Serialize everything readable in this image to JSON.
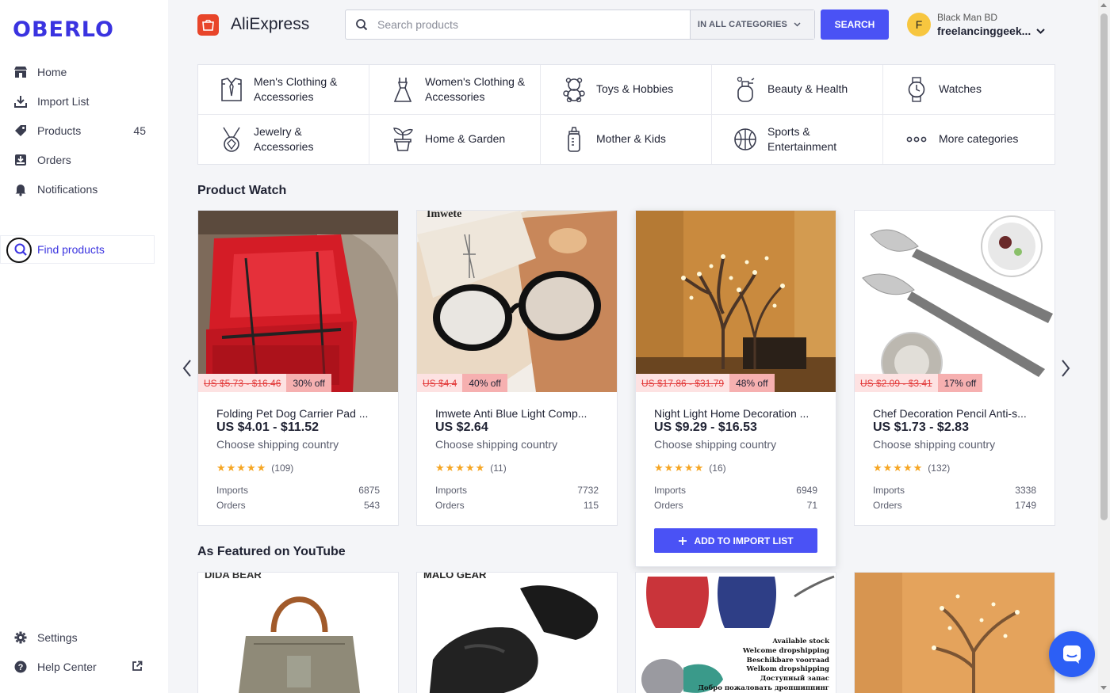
{
  "app": {
    "logo": "OBERLO"
  },
  "sidebar": {
    "items": [
      {
        "label": "Home",
        "icon": "store-icon"
      },
      {
        "label": "Import List",
        "icon": "download-icon"
      },
      {
        "label": "Products",
        "icon": "tag-icon",
        "count": "45"
      },
      {
        "label": "Orders",
        "icon": "inbox-icon"
      },
      {
        "label": "Notifications",
        "icon": "bell-icon"
      },
      {
        "label": "Find products",
        "icon": "search-icon",
        "active": true
      }
    ],
    "bottom": [
      {
        "label": "Settings",
        "icon": "gear-icon"
      },
      {
        "label": "Help Center",
        "icon": "help-icon"
      }
    ]
  },
  "header": {
    "store_name": "AliExpress",
    "search_placeholder": "Search products",
    "category_select": "IN ALL CATEGORIES",
    "search_button": "SEARCH",
    "user": {
      "initial": "F",
      "name": "Black Man BD",
      "email": "freelancinggeek..."
    }
  },
  "categories": [
    {
      "label": "Men's Clothing & Accessories",
      "icon": "shirt-tie-icon"
    },
    {
      "label": "Women's Clothing & Accessories",
      "icon": "dress-icon"
    },
    {
      "label": "Toys & Hobbies",
      "icon": "teddy-bear-icon"
    },
    {
      "label": "Beauty & Health",
      "icon": "perfume-icon"
    },
    {
      "label": "Watches",
      "icon": "watch-icon"
    },
    {
      "label": "Jewelry & Accessories",
      "icon": "necklace-icon"
    },
    {
      "label": "Home & Garden",
      "icon": "plant-pot-icon"
    },
    {
      "label": "Mother & Kids",
      "icon": "baby-bottle-icon"
    },
    {
      "label": "Sports & Entertainment",
      "icon": "basketball-icon"
    },
    {
      "label": "More categories",
      "icon": "more-dots-icon"
    }
  ],
  "product_watch": {
    "title": "Product Watch",
    "imports_label": "Imports",
    "orders_label": "Orders",
    "add_button": "ADD TO IMPORT LIST",
    "products": [
      {
        "title": "Folding Pet Dog Carrier Pad ...",
        "old_price": "US $5.73 - $16.46",
        "discount": "30% off",
        "price": "US $4.01 - $11.52",
        "shipping": "Choose shipping country",
        "reviews": "(109)",
        "imports": "6875",
        "orders": "543"
      },
      {
        "title": "Imwete Anti Blue Light Comp...",
        "old_price": "US $4.4",
        "discount": "40% off",
        "price": "US $2.64",
        "shipping": "Choose shipping country",
        "reviews": "(11)",
        "imports": "7732",
        "orders": "115"
      },
      {
        "title": "Night Light Home Decoration ...",
        "old_price": "US $17.86 - $31.79",
        "discount": "48% off",
        "price": "US $9.29 - $16.53",
        "shipping": "Choose shipping country",
        "reviews": "(16)",
        "imports": "6949",
        "orders": "71"
      },
      {
        "title": "Chef Decoration Pencil Anti-s...",
        "old_price": "US $2.09 - $3.41",
        "discount": "17% off",
        "price": "US $1.73 - $2.83",
        "shipping": "Choose shipping country",
        "reviews": "(132)",
        "imports": "3338",
        "orders": "1749"
      }
    ]
  },
  "youtube": {
    "title": "As Featured on YouTube",
    "cards": [
      {
        "brand": "DIDA BEAR",
        "icon": "handbag-icon"
      },
      {
        "brand": "MALO GEAR",
        "icon": "glove-icon"
      },
      {
        "brand": "",
        "icon": "pet-harness-icon",
        "caption_lines": [
          "Available stock",
          "Welcome dropshipping",
          "Beschikbare voorraad",
          "Welkom dropshipping",
          "Доступный запас",
          "Добро пожаловать дропшиппинг"
        ]
      },
      {
        "brand": "",
        "icon": "tree-lamp-icon"
      }
    ]
  },
  "colors": {
    "brand": "#3a33e0",
    "accent": "#4a52f5",
    "discount_bg": "#f6b0b0",
    "old_price": "#e23b3b",
    "star": "#f6a623",
    "chat": "#2c5ff5"
  }
}
